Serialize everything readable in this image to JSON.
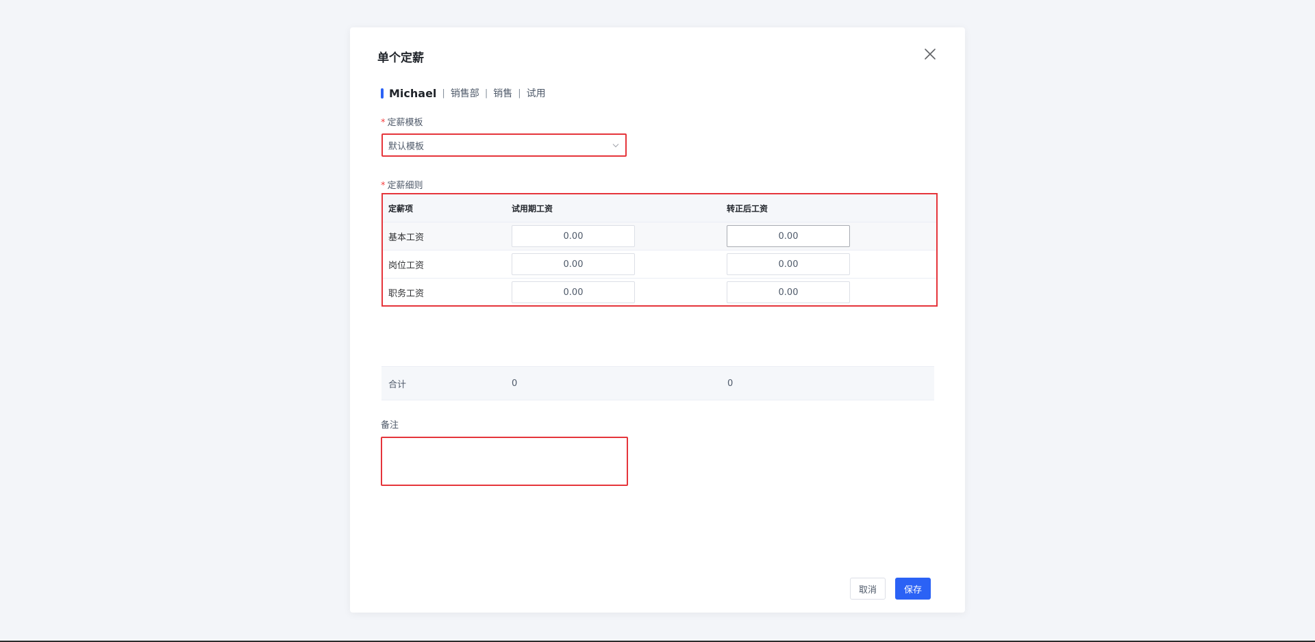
{
  "modal": {
    "title": "单个定薪",
    "close_icon": "close-icon"
  },
  "employee": {
    "name": "Michael",
    "department": "销售部",
    "position": "销售",
    "status": "试用",
    "separator": "|"
  },
  "template_field": {
    "required_mark": "*",
    "label": "定薪模板",
    "value": "默认模板"
  },
  "rules_field": {
    "required_mark": "*",
    "label": "定薪细则"
  },
  "table": {
    "headers": [
      "定薪项",
      "试用期工资",
      "转正后工资"
    ],
    "rows": [
      {
        "item": "基本工资",
        "probation": "0.00",
        "regular": "0.00"
      },
      {
        "item": "岗位工资",
        "probation": "0.00",
        "regular": "0.00"
      },
      {
        "item": "职务工资",
        "probation": "0.00",
        "regular": "0.00"
      }
    ]
  },
  "total": {
    "label": "合计",
    "probation": "0",
    "regular": "0"
  },
  "remark": {
    "label": "备注",
    "value": ""
  },
  "footer": {
    "cancel_label": "取消",
    "save_label": "保存"
  },
  "colors": {
    "primary": "#2b62f5",
    "highlight_border": "#e5343a",
    "required": "#f53f3f"
  }
}
